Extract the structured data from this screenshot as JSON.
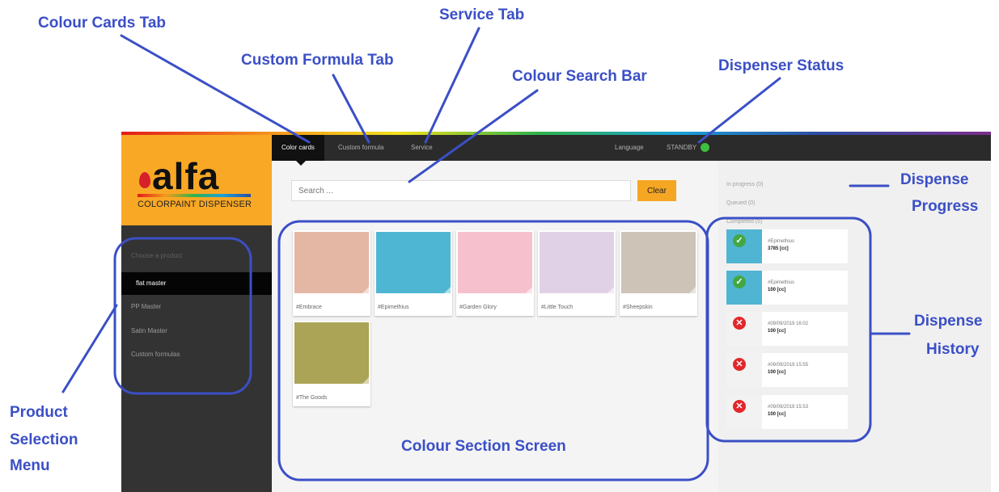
{
  "annotations": {
    "colour_cards_tab": "Colour Cards Tab",
    "service_tab": "Service Tab",
    "custom_formula_tab": "Custom Formula Tab",
    "colour_search_bar": "Colour Search Bar",
    "dispenser_status": "Dispenser Status",
    "dispense_progress_1": "Dispense",
    "dispense_progress_2": "Progress",
    "dispense_history_1": "Dispense",
    "dispense_history_2": "History",
    "product_selection_1": "Product",
    "product_selection_2": "Selection",
    "product_selection_3": "Menu",
    "colour_section_screen": "Colour Section Screen",
    "color": "#3b4fc6"
  },
  "app": {
    "logo": {
      "word": "alfa",
      "subtitle": "COLORPAINT DISPENSER"
    },
    "sidebar": {
      "heading": "Choose a product",
      "items": [
        {
          "label": "flat master",
          "active": true
        },
        {
          "label": "PP Master"
        },
        {
          "label": "Satin Master"
        },
        {
          "label": "Custom formulas"
        }
      ]
    },
    "tabs": [
      {
        "label": "Color cards",
        "active": true
      },
      {
        "label": "Custom formula"
      },
      {
        "label": "Service"
      }
    ],
    "language_label": "Language",
    "status": {
      "label": "STANDBY",
      "color": "#3fbf3f"
    },
    "search": {
      "placeholder": "Search ..."
    },
    "clear_label": "Clear",
    "cards": [
      {
        "label": "#Embrace",
        "color": "#e4b6a4"
      },
      {
        "label": "#Epimethius",
        "color": "#4eb6d3"
      },
      {
        "label": "#Garden Glory",
        "color": "#f6c1cc"
      },
      {
        "label": "#Little Touch",
        "color": "#e1d1e6"
      },
      {
        "label": "#Sheepskin",
        "color": "#cdc3b7"
      },
      {
        "label": "#The Goods",
        "color": "#aba456"
      }
    ],
    "progress": {
      "in_progress": "In progress (0)",
      "queued": "Queued (0)",
      "completed": "Completed (5)"
    },
    "history": [
      {
        "status": "ok",
        "title": "#Epimethius",
        "amount": "3785 [cc]"
      },
      {
        "status": "ok",
        "title": "#Epimethius",
        "amount": "100 [cc]"
      },
      {
        "status": "err",
        "title": "#09/09/2019 16:02",
        "amount": "100 [cc]"
      },
      {
        "status": "err",
        "title": "#09/09/2019 15:55",
        "amount": "100 [cc]"
      },
      {
        "status": "err",
        "title": "#09/09/2019 15:53",
        "amount": "100 [cc]"
      }
    ]
  }
}
